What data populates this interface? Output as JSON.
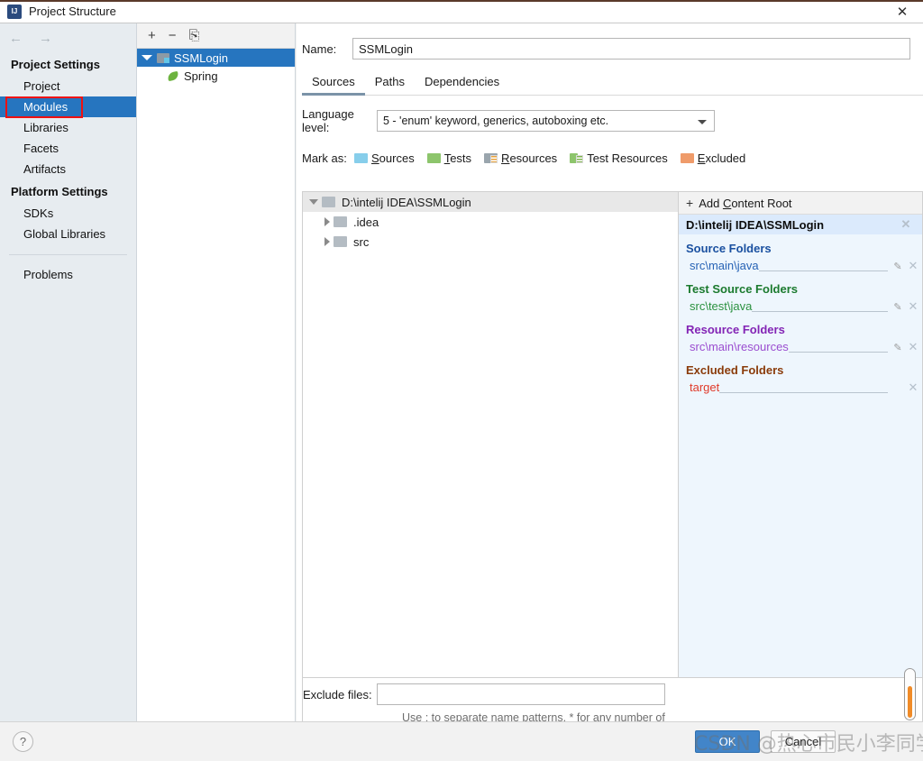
{
  "window": {
    "title": "Project Structure",
    "app_icon": "intellij-idea-icon",
    "close_icon": "close-icon"
  },
  "sidebar": {
    "nav_back_icon": "arrow-left-icon",
    "nav_forward_icon": "arrow-right-icon",
    "groups": [
      {
        "label": "Project Settings",
        "items": [
          {
            "label": "Project",
            "selected": false
          },
          {
            "label": "Modules",
            "selected": true
          },
          {
            "label": "Libraries",
            "selected": false
          },
          {
            "label": "Facets",
            "selected": false
          },
          {
            "label": "Artifacts",
            "selected": false
          }
        ]
      },
      {
        "label": "Platform Settings",
        "items": [
          {
            "label": "SDKs",
            "selected": false
          },
          {
            "label": "Global Libraries",
            "selected": false
          }
        ]
      }
    ],
    "problems_label": "Problems",
    "highlight_color": "#ee1111",
    "selection_color": "#2675bf"
  },
  "module_pane": {
    "toolbar": {
      "add_label": "+",
      "remove_label": "−",
      "copy_label": "⎘"
    },
    "tree": [
      {
        "label": "SSMLogin",
        "icon": "module-icon",
        "selected": true
      },
      {
        "label": "Spring",
        "icon": "spring-leaf-icon",
        "selected": false
      }
    ]
  },
  "main": {
    "name_label": "Name:",
    "name_value": "SSMLogin",
    "tabs": [
      {
        "label": "Sources",
        "active": true
      },
      {
        "label": "Paths",
        "active": false
      },
      {
        "label": "Dependencies",
        "active": false
      }
    ],
    "language_level": {
      "label": "Language level:",
      "value": "5 - 'enum' keyword, generics, autoboxing etc.",
      "dropdown_icon": "chevron-down-icon"
    },
    "mark_as": {
      "label": "Mark as:",
      "options": [
        {
          "label": "Sources",
          "mnemonic": "S",
          "color": "#87ceeb",
          "icon": "folder-sources-icon"
        },
        {
          "label": "Tests",
          "mnemonic": "T",
          "color": "#8dc56c",
          "icon": "folder-tests-icon"
        },
        {
          "label": "Resources",
          "mnemonic": "R",
          "color": "#9aa5ad",
          "icon": "folder-resources-icon"
        },
        {
          "label": "Test Resources",
          "mnemonic": "",
          "color": "#8dc56c",
          "icon": "folder-test-resources-icon"
        },
        {
          "label": "Excluded",
          "mnemonic": "E",
          "color": "#ef9b6a",
          "icon": "folder-excluded-icon"
        }
      ]
    },
    "file_tree": [
      {
        "label": "D:\\intelij IDEA\\SSMLogin",
        "expanded": true,
        "level": 0
      },
      {
        "label": ".idea",
        "expanded": false,
        "level": 1
      },
      {
        "label": "src",
        "expanded": false,
        "level": 1
      }
    ],
    "content_root_panel": {
      "add_content_root_label": "Add Content Root",
      "add_icon": "plus-icon",
      "root_path": "D:\\intelij IDEA\\SSMLogin",
      "root_remove_icon": "close-icon",
      "sections": [
        {
          "title": "Source Folders",
          "color": "#1a50a0",
          "paths": [
            {
              "value": "src\\main\\java",
              "editable": true,
              "removable": true
            }
          ]
        },
        {
          "title": "Test Source Folders",
          "color": "#1b7a2e",
          "paths": [
            {
              "value": "src\\test\\java",
              "editable": true,
              "removable": true
            }
          ]
        },
        {
          "title": "Resource Folders",
          "color": "#8324b5",
          "paths": [
            {
              "value": "src\\main\\resources",
              "editable": true,
              "removable": true
            }
          ]
        },
        {
          "title": "Excluded Folders",
          "color": "#8a3b0a",
          "paths": [
            {
              "value": "target",
              "editable": false,
              "removable": true
            }
          ]
        }
      ],
      "edit_icon": "pencil-icon",
      "remove_icon": "close-icon"
    },
    "exclude_files": {
      "label": "Exclude files:",
      "value": "",
      "placeholder": "",
      "hint": "Use ; to separate name patterns, * for any number of symbols, ? for one."
    }
  },
  "footer": {
    "help_label": "?",
    "help_icon": "help-icon",
    "ok_label": "OK",
    "cancel_label": "Cancel",
    "watermark": "CSDN @热心市民小李同学"
  },
  "right_slider": {
    "name": "vertical-slider",
    "thumb_color": "#f08b28"
  }
}
